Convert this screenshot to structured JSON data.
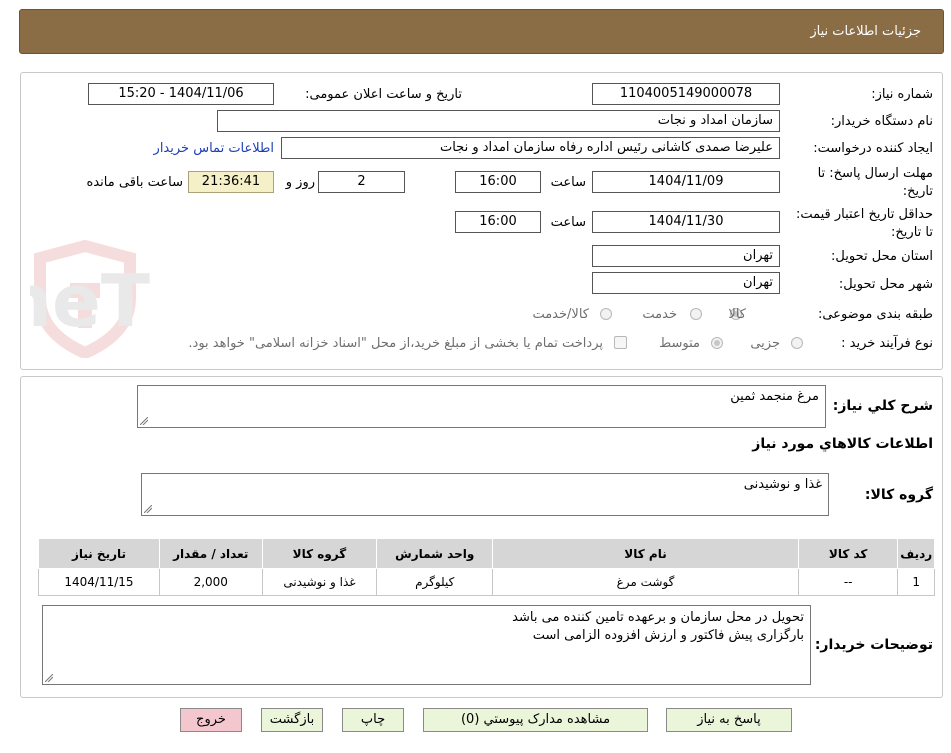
{
  "header": {
    "title": "جزئیات اطلاعات نیاز"
  },
  "watermark": {
    "text": "AriaTender.neT"
  },
  "info": {
    "need_number_label": "شماره نیاز:",
    "need_number": "1104005149000078",
    "announce_label": "تاریخ و ساعت اعلان عمومی:",
    "announce_value": "1404/11/06 - 15:20",
    "buyer_org_label": "نام دستگاه خریدار:",
    "buyer_org": "سازمان امداد و نجات",
    "creator_label": "ایجاد کننده درخواست:",
    "creator": "علیرضا صمدی کاشانی رئیس اداره رفاه  سازمان امداد و نجات",
    "contact_link": "اطلاعات تماس خریدار",
    "deadline_label": "مهلت ارسال پاسخ: تا تاریخ:",
    "deadline_date": "1404/11/09",
    "time_label": "ساعت",
    "deadline_time": "16:00",
    "days_value": "2",
    "days_label": "روز و",
    "remaining_time": "21:36:41",
    "remaining_label": "ساعت باقی مانده",
    "validity_label": "حداقل تاریخ اعتبار قیمت: تا تاریخ:",
    "validity_date": "1404/11/30",
    "validity_time": "16:00",
    "province_label": "استان محل تحویل:",
    "province": "تهران",
    "city_label": "شهر محل تحویل:",
    "city": "تهران",
    "category_label": "طبقه بندی موضوعی:",
    "category_options": [
      "کالا",
      "خدمت",
      "کالا/خدمت"
    ],
    "category_selected": "کالا",
    "process_label": "نوع فرآیند خرید :",
    "process_options": [
      "جزیی",
      "متوسط"
    ],
    "process_selected": "متوسط",
    "payment_note": "پرداخت تمام یا بخشی از مبلغ خرید،از محل \"اسناد خزانه اسلامی\" خواهد بود."
  },
  "summary": {
    "label": "شرح کلي نياز:",
    "value": "مرغ منجمد ثمین",
    "goods_info_title": "اطلاعات کالاهاي مورد نياز",
    "goods_group_label": "گروه کالا:",
    "goods_group_value": "غذا و نوشیدنی"
  },
  "table": {
    "headers": [
      "رديف",
      "کد کالا",
      "نام کالا",
      "واحد شمارش",
      "گروه کالا",
      "تعداد / مقدار",
      "تاریخ نیاز"
    ],
    "rows": [
      [
        "1",
        "--",
        "گوشت مرغ",
        "کیلوگرم",
        "غذا و نوشیدنی",
        "2,000",
        "1404/11/15"
      ]
    ]
  },
  "notes": {
    "label": "توضیحات خریدار:",
    "line1": "تحویل در محل سازمان و برعهده تامین کننده می باشد",
    "line2": "بارگزاری پیش فاکتور و ارزش افزوده الزامی است"
  },
  "buttons": {
    "reply": "پاسخ به نیاز",
    "attachments": "مشاهده مدارک پیوستي (0)",
    "print": "چاپ",
    "back": "بازگشت",
    "exit": "خروج"
  },
  "colors": {
    "header_bg": "#8a6d45",
    "button_bg": "#eaf5da",
    "button_exit_bg": "#f4c7cf",
    "remaining_bg": "#f5f0c8",
    "link": "#1b3fb8"
  }
}
